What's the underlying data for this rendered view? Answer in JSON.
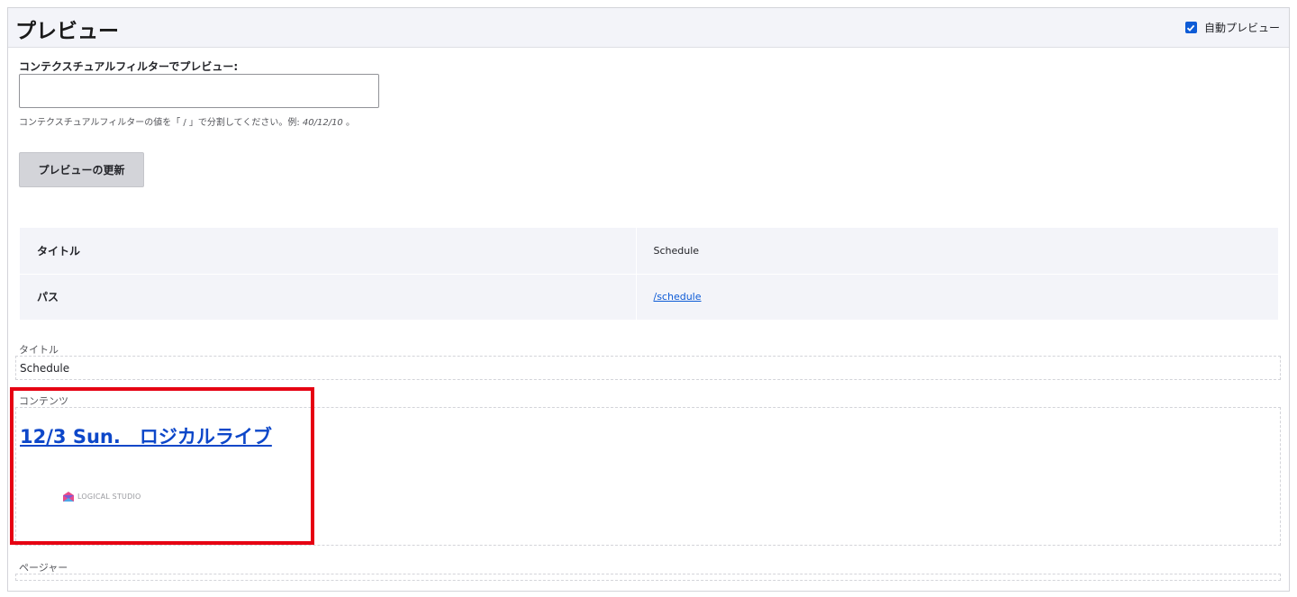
{
  "panel": {
    "title": "プレビュー",
    "auto_preview": {
      "label": "自動プレビュー",
      "checked": true
    }
  },
  "filter": {
    "label": "コンテクスチュアルフィルターでプレビュー:",
    "value": "",
    "description_prefix": "コンテクスチュアルフィルターの値を「 / 」で分割してください。例: ",
    "description_example": "40/12/10",
    "description_suffix": " 。"
  },
  "update_button": {
    "label": "プレビューの更新"
  },
  "info_table": [
    {
      "key": "タイトル",
      "value": "Schedule"
    },
    {
      "key": "パス",
      "value": "/schedule"
    }
  ],
  "fields": {
    "title": {
      "label": "タイトル",
      "value": "Schedule"
    },
    "content": {
      "label": "コンテンツ",
      "link_text": "12/3 Sun.　ロジカルライブ",
      "logo_text": "LOGICAL STUDIO"
    },
    "pager": {
      "label": "ページャー"
    }
  },
  "colors": {
    "accent": "#0d5bd6",
    "link": "#0d47c9",
    "highlight": "#e60012"
  }
}
